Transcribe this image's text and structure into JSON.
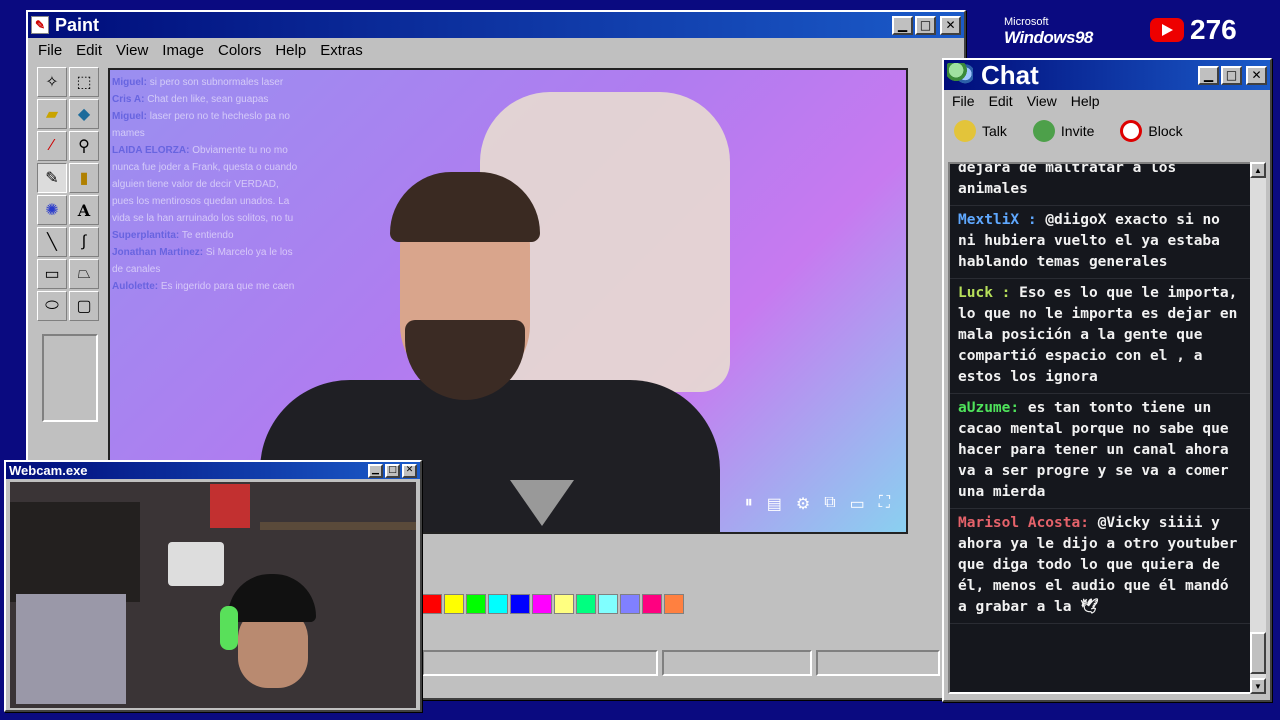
{
  "paint": {
    "title": "Paint",
    "menu": [
      "File",
      "Edit",
      "View",
      "Image",
      "Colors",
      "Help",
      "Extras"
    ],
    "tools": [
      "free-select",
      "rect-select",
      "eraser",
      "fill",
      "eyedropper",
      "magnifier",
      "pencil",
      "brush",
      "airbrush",
      "text",
      "line",
      "curve",
      "rectangle",
      "polygon",
      "ellipse",
      "rounded-rect"
    ],
    "canvas_chat": [
      {
        "name": "Miguel:",
        "text": "si pero son subnormales laser"
      },
      {
        "name": "Cris A:",
        "text": "Chat den like, sean guapas"
      },
      {
        "name": "Miguel:",
        "text": "laser pero no te hecheslo pa no mames"
      },
      {
        "name": "LAIDA ELORZA:",
        "text": "Obviamente tu no mo nunca fue joder a Frank, questa o cuando alguien tiene valor de decir VERDAD, pues los mentirosos quedan unados. La vida se la han arruinado los solitos, no tu"
      },
      {
        "name": "Superplantita:",
        "text": "Te entiendo"
      },
      {
        "name": "Jonathan Martinez:",
        "text": "Si Marcelo ya le los de canales"
      },
      {
        "name": "Aulolette:",
        "text": "Es ingerido para que me caen"
      }
    ],
    "palette": [
      "#ff0000",
      "#ffff00",
      "#00ff00",
      "#00ffff",
      "#0000ff",
      "#ff00ff",
      "#ffff80",
      "#00ff80",
      "#80ffff",
      "#8080ff",
      "#ff0080",
      "#ff8040"
    ]
  },
  "branding": {
    "ms": "Microsoft",
    "win": "Windows98",
    "yt_count": "276"
  },
  "chat": {
    "title": "Chat",
    "menu": [
      "File",
      "Edit",
      "View",
      "Help"
    ],
    "tools": [
      {
        "label": "Talk",
        "icon": "talk-icon"
      },
      {
        "label": "Invite",
        "icon": "invite-icon"
      },
      {
        "label": "Block",
        "icon": "block-icon"
      }
    ],
    "messages": [
      {
        "name": "",
        "color": "#f2f2f2",
        "text": "dejara de maltratar a los animales"
      },
      {
        "name": "MextliX :",
        "color": "#5fa8ff",
        "text": "@diigoX exacto si no ni hubiera vuelto el ya estaba hablando temas generales"
      },
      {
        "name": "Luck :",
        "color": "#b7e05a",
        "text": "Eso es lo que le importa, lo que no le importa es dejar en mala posición a la gente que compartió espacio con el , a estos los ignora"
      },
      {
        "name": "aUzume:",
        "color": "#4fe35b",
        "text": "es tan tonto tiene un cacao mental porque no sabe que hacer para tener un canal ahora va a ser progre y se va a comer una mierda"
      },
      {
        "name": "Marisol Acosta:",
        "color": "#e5626a",
        "text": "@Vicky siiii y ahora ya le dijo a otro youtuber que diga todo lo que quiera de él, menos el audio que él mandó a grabar a la 🕊"
      }
    ]
  },
  "webcam": {
    "title": "Webcam.exe"
  }
}
